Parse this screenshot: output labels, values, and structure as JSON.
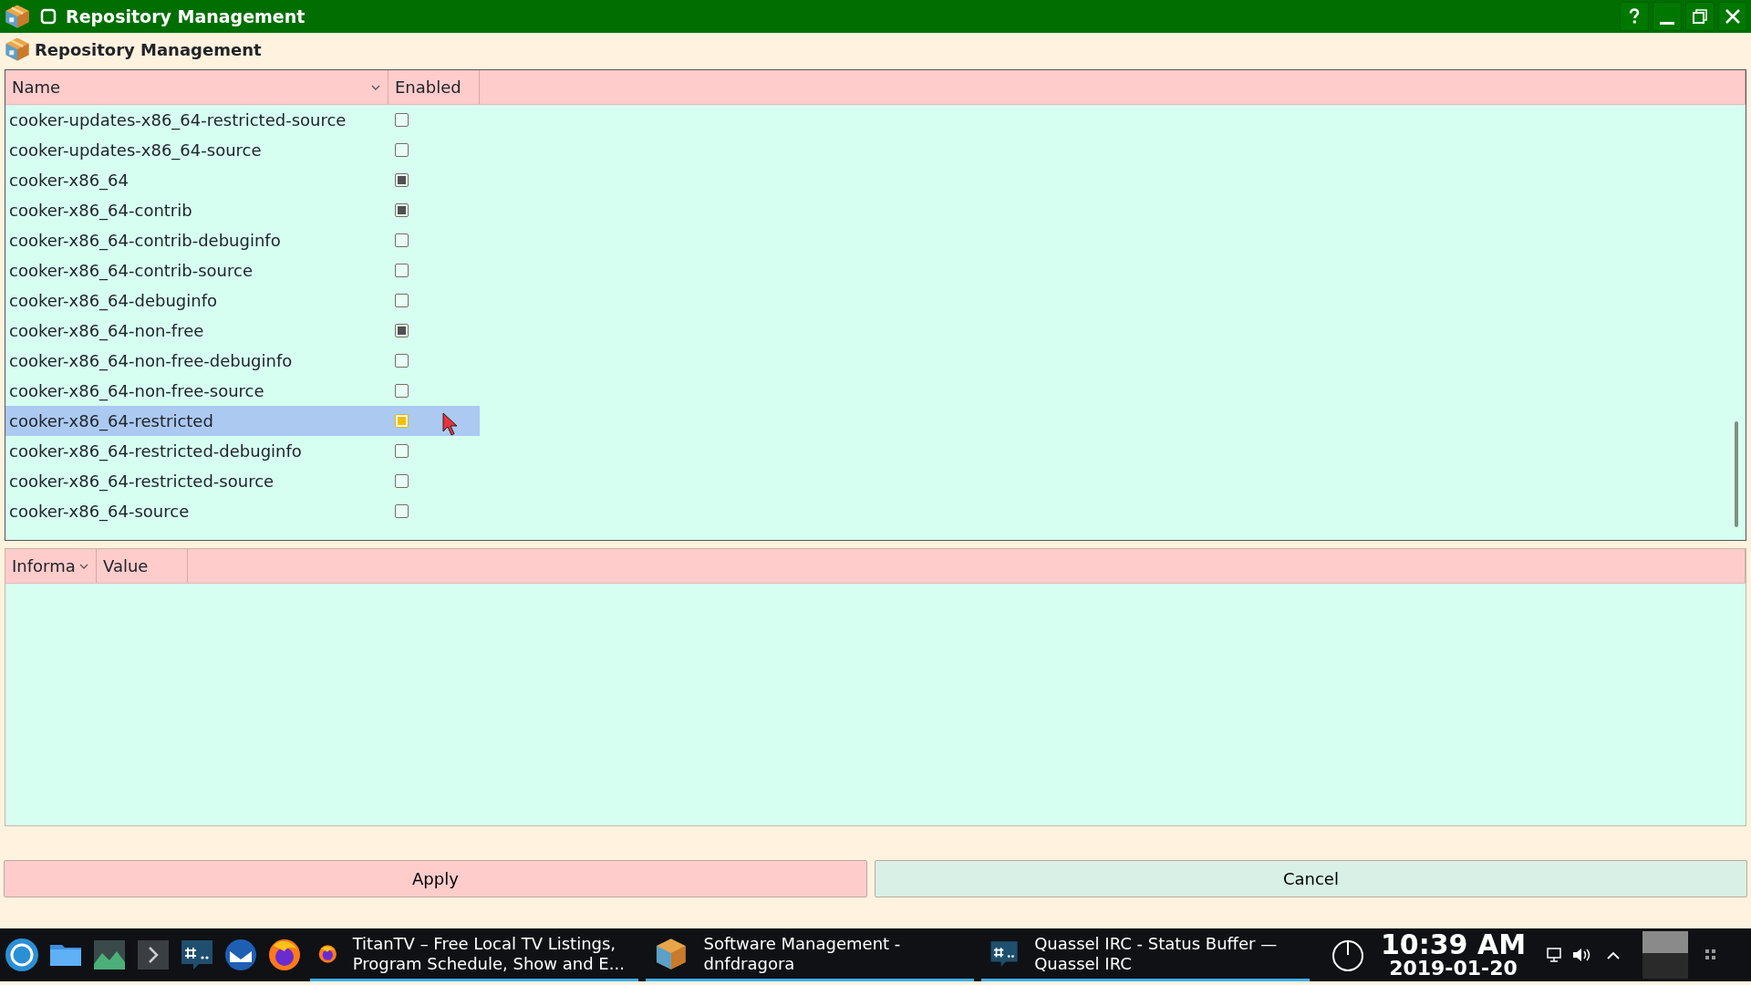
{
  "window": {
    "title": "Repository Management"
  },
  "header": {
    "title": "Repository Management"
  },
  "repo_table": {
    "columns": [
      {
        "label": "Name",
        "sortable": true
      },
      {
        "label": "Enabled",
        "sortable": false
      }
    ],
    "rows": [
      {
        "name": "cooker-updates-x86_64-restricted-source",
        "enabled": false,
        "selected": false
      },
      {
        "name": "cooker-updates-x86_64-source",
        "enabled": false,
        "selected": false
      },
      {
        "name": "cooker-x86_64",
        "enabled": true,
        "selected": false
      },
      {
        "name": "cooker-x86_64-contrib",
        "enabled": true,
        "selected": false
      },
      {
        "name": "cooker-x86_64-contrib-debuginfo",
        "enabled": false,
        "selected": false
      },
      {
        "name": "cooker-x86_64-contrib-source",
        "enabled": false,
        "selected": false
      },
      {
        "name": "cooker-x86_64-debuginfo",
        "enabled": false,
        "selected": false
      },
      {
        "name": "cooker-x86_64-non-free",
        "enabled": true,
        "selected": false
      },
      {
        "name": "cooker-x86_64-non-free-debuginfo",
        "enabled": false,
        "selected": false
      },
      {
        "name": "cooker-x86_64-non-free-source",
        "enabled": false,
        "selected": false
      },
      {
        "name": "cooker-x86_64-restricted",
        "enabled": true,
        "selected": true
      },
      {
        "name": "cooker-x86_64-restricted-debuginfo",
        "enabled": false,
        "selected": false
      },
      {
        "name": "cooker-x86_64-restricted-source",
        "enabled": false,
        "selected": false
      },
      {
        "name": "cooker-x86_64-source",
        "enabled": false,
        "selected": false
      }
    ]
  },
  "info_table": {
    "columns": [
      {
        "label": "Informa",
        "sortable": true
      },
      {
        "label": "Value",
        "sortable": false
      }
    ]
  },
  "buttons": [
    {
      "label": "Apply",
      "kind": "apply"
    },
    {
      "label": "Cancel",
      "kind": "cancel"
    }
  ],
  "taskbar": {
    "launchers": [
      {
        "kind": "launcher"
      },
      {
        "kind": "files"
      },
      {
        "kind": "system"
      },
      {
        "kind": "terminal"
      },
      {
        "kind": "irc"
      },
      {
        "kind": "mail"
      },
      {
        "kind": "browser"
      }
    ],
    "tasks": [
      {
        "label": "TitanTV – Free Local TV Listings, Program Schedule, Show and E...",
        "kind": "browser"
      },
      {
        "label": "Software Management - dnfdragora",
        "kind": "package"
      },
      {
        "label": "Quassel IRC - Status Buffer — Quassel IRC",
        "kind": "irc"
      }
    ],
    "time": "10:39 AM",
    "date": "2019-01-20"
  }
}
